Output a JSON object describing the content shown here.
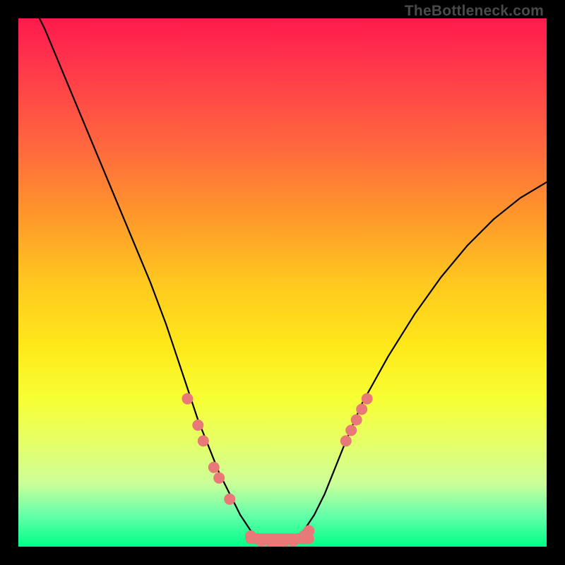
{
  "watermark": "TheBottleneck.com",
  "colors": {
    "frame": "#000000",
    "curve": "#000000",
    "marker": "#e97878",
    "gradient_top": "#ff1a4d",
    "gradient_bottom": "#00ff88"
  },
  "chart_data": {
    "type": "line",
    "title": "",
    "xlabel": "",
    "ylabel": "",
    "xlim": [
      0,
      100
    ],
    "ylim": [
      0,
      100
    ],
    "x": [
      0,
      5,
      10,
      15,
      20,
      25,
      28,
      30,
      32,
      34,
      36,
      38,
      40,
      42,
      44,
      46,
      48,
      50,
      52,
      54,
      56,
      58,
      60,
      62,
      65,
      70,
      75,
      80,
      85,
      90,
      95,
      100
    ],
    "values": [
      108,
      98,
      86,
      74,
      62,
      50,
      42,
      36,
      30,
      24,
      19,
      14,
      10,
      6,
      3,
      1,
      0.5,
      0.5,
      1,
      3,
      6,
      10,
      15,
      20,
      27,
      36,
      44,
      51,
      57,
      62,
      66,
      69
    ],
    "markers": [
      {
        "x": 32,
        "y": 28
      },
      {
        "x": 34,
        "y": 23
      },
      {
        "x": 35,
        "y": 20
      },
      {
        "x": 37,
        "y": 15
      },
      {
        "x": 38,
        "y": 13
      },
      {
        "x": 40,
        "y": 9
      },
      {
        "x": 44,
        "y": 2
      },
      {
        "x": 46,
        "y": 1
      },
      {
        "x": 48,
        "y": 0.5
      },
      {
        "x": 50,
        "y": 0.5
      },
      {
        "x": 52,
        "y": 1
      },
      {
        "x": 54,
        "y": 2
      },
      {
        "x": 55,
        "y": 3
      },
      {
        "x": 62,
        "y": 20
      },
      {
        "x": 63,
        "y": 22
      },
      {
        "x": 64,
        "y": 24
      },
      {
        "x": 65,
        "y": 26
      },
      {
        "x": 66,
        "y": 28
      }
    ]
  }
}
